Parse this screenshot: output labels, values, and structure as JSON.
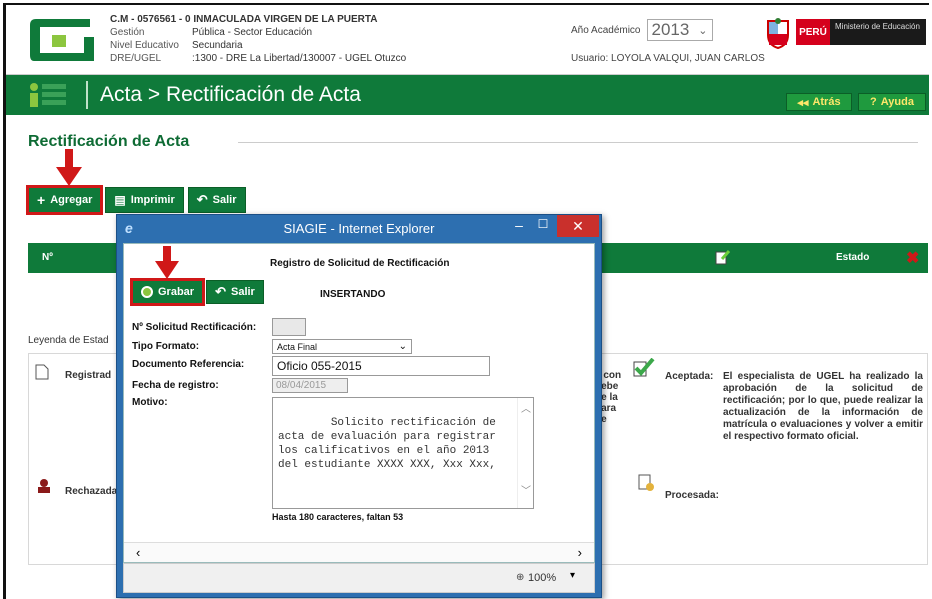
{
  "header": {
    "institution_line": "C.M - 0576561 - 0  INMACULADA VIRGEN DE LA PUERTA",
    "rows": [
      {
        "label": "Gestión",
        "value": "Pública - Sector Educación"
      },
      {
        "label": "Nivel Educativo",
        "value": "Secundaria"
      },
      {
        "label": "DRE/UGEL",
        "value": ":1300 - DRE La Libertad/130007 - UGEL Otuzco"
      }
    ],
    "year_label": "Año Académico",
    "year_value": "2013",
    "user_line": "Usuario: LOYOLA VALQUI, JUAN CARLOS",
    "peru": "PERÚ",
    "ministry": "Ministerio de Educación"
  },
  "titlebar": {
    "title": "Acta > Rectificación de Acta",
    "back_label": "Atrás",
    "help_label": "Ayuda"
  },
  "main": {
    "page_title": "Rectificación de Acta",
    "toolbar": {
      "add": "Agregar",
      "print": "Imprimir",
      "exit": "Salir"
    },
    "grid": {
      "col_nro": "Nº",
      "col_estado": "Estado"
    },
    "legend_label": "Leyenda de Estad",
    "legend": {
      "registrada": "Registrad",
      "rechazada": "Rechazada",
      "aceptada_label": "Aceptada:",
      "aceptada_text": "El especialista de UGEL ha realizado la aprobación de la solicitud de rectificación; por lo que, puede realizar la actualización de la información de matrícula o evaluaciones y volver a emitir el respectivo formato oficial.",
      "procesada_label": "Procesada:",
      "partial_text": "a con\ndebe\nde la\npara\nde"
    }
  },
  "dialog": {
    "window_title": "SIAGIE - Internet Explorer",
    "heading": "Registro de Solicitud de Rectificación",
    "save": "Grabar",
    "exit": "Salir",
    "mode": "INSERTANDO",
    "fields": {
      "nro_label": "Nº Solicitud Rectificación:",
      "tipo_label": "Tipo Formato:",
      "tipo_value": "Acta Final",
      "doc_label": "Documento Referencia:",
      "doc_value": "Oficio 055-2015",
      "fecha_label": "Fecha de registro:",
      "fecha_value": "08/04/2015",
      "motivo_label": "Motivo:",
      "motivo_value": "Solicito rectificación de acta de evaluación para registrar los calificativos en el año 2013 del estudiante XXXX XXX, Xxx Xxx,",
      "hint": "Hasta 180 caracteres, faltan 53"
    },
    "zoom": "100%"
  }
}
